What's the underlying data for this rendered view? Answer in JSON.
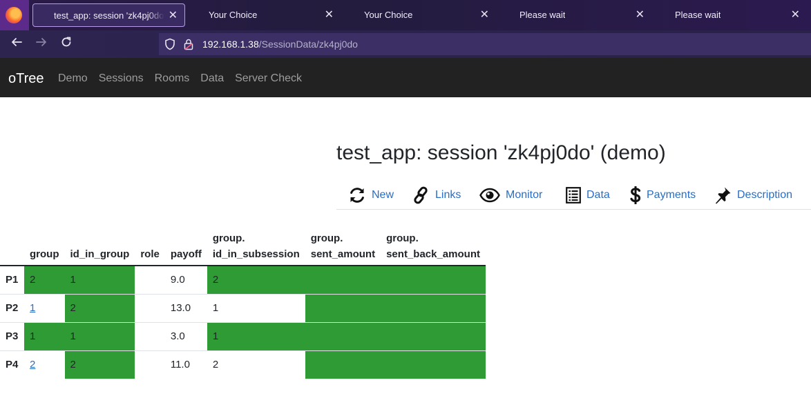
{
  "browser": {
    "tabs": [
      {
        "label": "test_app: session 'zk4pj0do' (demo)",
        "active": true
      },
      {
        "label": "Your Choice",
        "active": false
      },
      {
        "label": "Your Choice",
        "active": false
      },
      {
        "label": "Please wait",
        "active": false
      },
      {
        "label": "Please wait",
        "active": false
      }
    ],
    "url_host": "192.168.1.38",
    "url_path": "/SessionData/zk4pj0do",
    "icons": {
      "back": "back-arrow-icon",
      "forward": "forward-arrow-icon",
      "reload": "reload-icon",
      "shield": "shield-icon",
      "lock": "lock-icon"
    }
  },
  "otree_nav": {
    "brand": "oTree",
    "links": [
      "Demo",
      "Sessions",
      "Rooms",
      "Data",
      "Server Check"
    ]
  },
  "page": {
    "title": "test_app: session 'zk4pj0do' (demo)",
    "actions": [
      {
        "label": "New",
        "icon": "refresh-icon"
      },
      {
        "label": "Links",
        "icon": "link-icon"
      },
      {
        "label": "Monitor",
        "icon": "eye-icon"
      },
      {
        "label": "Data",
        "icon": "list-icon"
      },
      {
        "label": "Payments",
        "icon": "dollar-icon"
      },
      {
        "label": "Description",
        "icon": "pin-icon"
      }
    ]
  },
  "table": {
    "headers": [
      {
        "line1": "",
        "line2": "group"
      },
      {
        "line1": "",
        "line2": "id_in_group"
      },
      {
        "line1": "",
        "line2": "role"
      },
      {
        "line1": "",
        "line2": "payoff"
      },
      {
        "line1": "group.",
        "line2": "id_in_subsession"
      },
      {
        "line1": "group.",
        "line2": "sent_amount"
      },
      {
        "line1": "group.",
        "line2": "sent_back_amount"
      }
    ],
    "rows": [
      {
        "label": "P1",
        "group": "2",
        "id_in_group": "1",
        "role": "",
        "payoff": "9.0",
        "id_in_subsession": "2",
        "sent_amount": "",
        "sent_back_amount": ""
      },
      {
        "label": "P2",
        "group": "1",
        "id_in_group": "2",
        "role": "",
        "payoff": "13.0",
        "id_in_subsession": "1",
        "sent_amount": "",
        "sent_back_amount": ""
      },
      {
        "label": "P3",
        "group": "1",
        "id_in_group": "1",
        "role": "",
        "payoff": "3.0",
        "id_in_subsession": "1",
        "sent_amount": "",
        "sent_back_amount": ""
      },
      {
        "label": "P4",
        "group": "2",
        "id_in_group": "2",
        "role": "",
        "payoff": "11.0",
        "id_in_subsession": "2",
        "sent_amount": "",
        "sent_back_amount": ""
      }
    ],
    "highlight_color": "#2e9b35"
  }
}
